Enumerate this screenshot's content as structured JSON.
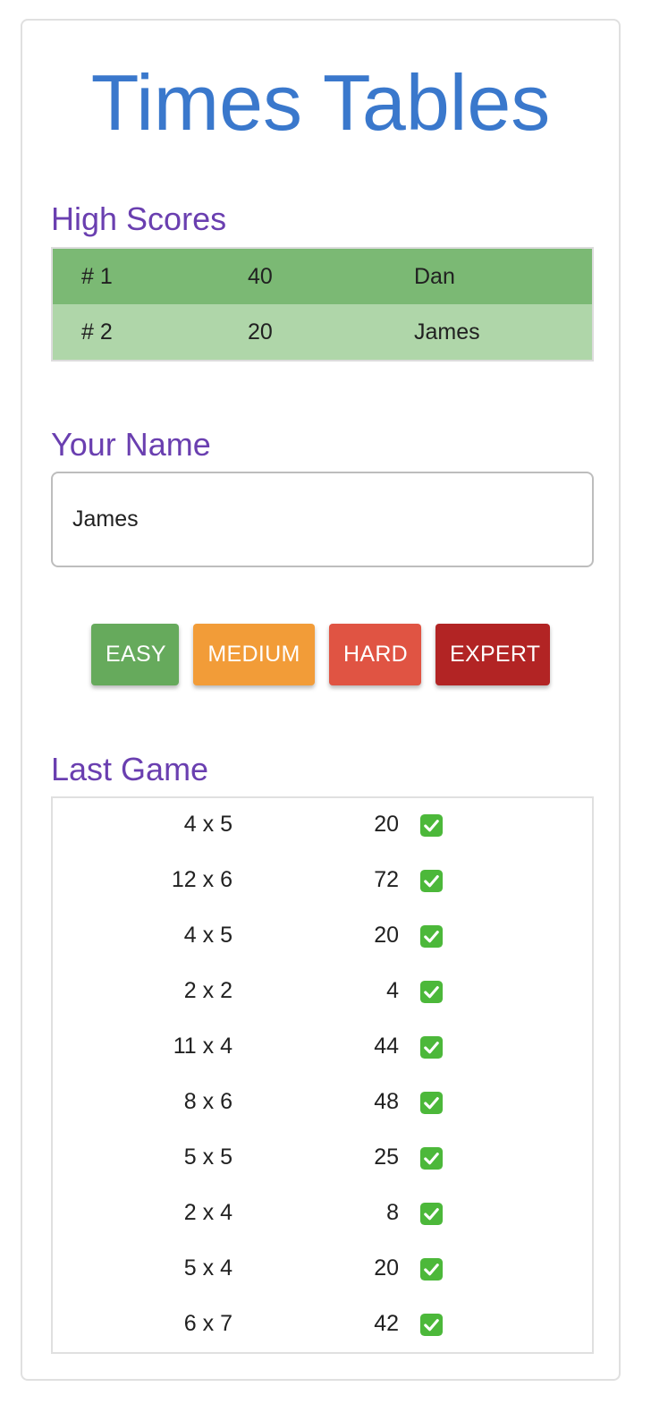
{
  "app": {
    "title": "Times Tables"
  },
  "high_scores": {
    "title": "High Scores",
    "rows": [
      {
        "rank": "# 1",
        "score": "40",
        "name": "Dan"
      },
      {
        "rank": "# 2",
        "score": "20",
        "name": "James"
      }
    ]
  },
  "name_section": {
    "title": "Your Name",
    "value": "James"
  },
  "difficulty": {
    "easy": "EASY",
    "medium": "MEDIUM",
    "hard": "HARD",
    "expert": "EXPERT"
  },
  "last_game": {
    "title": "Last Game",
    "rows": [
      {
        "question": "4 x 5",
        "answer": "20",
        "status": "check-icon"
      },
      {
        "question": "12 x 6",
        "answer": "72",
        "status": "check-icon"
      },
      {
        "question": "4 x 5",
        "answer": "20",
        "status": "check-icon"
      },
      {
        "question": "2 x 2",
        "answer": "4",
        "status": "check-icon"
      },
      {
        "question": "11 x 4",
        "answer": "44",
        "status": "check-icon"
      },
      {
        "question": "8 x 6",
        "answer": "48",
        "status": "check-icon"
      },
      {
        "question": "5 x 5",
        "answer": "25",
        "status": "check-icon"
      },
      {
        "question": "2 x 4",
        "answer": "8",
        "status": "check-icon"
      },
      {
        "question": "5 x 4",
        "answer": "20",
        "status": "check-icon"
      },
      {
        "question": "6 x 7",
        "answer": "42",
        "status": "check-icon"
      }
    ]
  },
  "colors": {
    "title": "#3a78cc",
    "section": "#6a3fb0",
    "easy": "#66aa5c",
    "medium": "#f29c38",
    "hard": "#e05443",
    "expert": "#b22424",
    "check": "#4cb83a"
  }
}
